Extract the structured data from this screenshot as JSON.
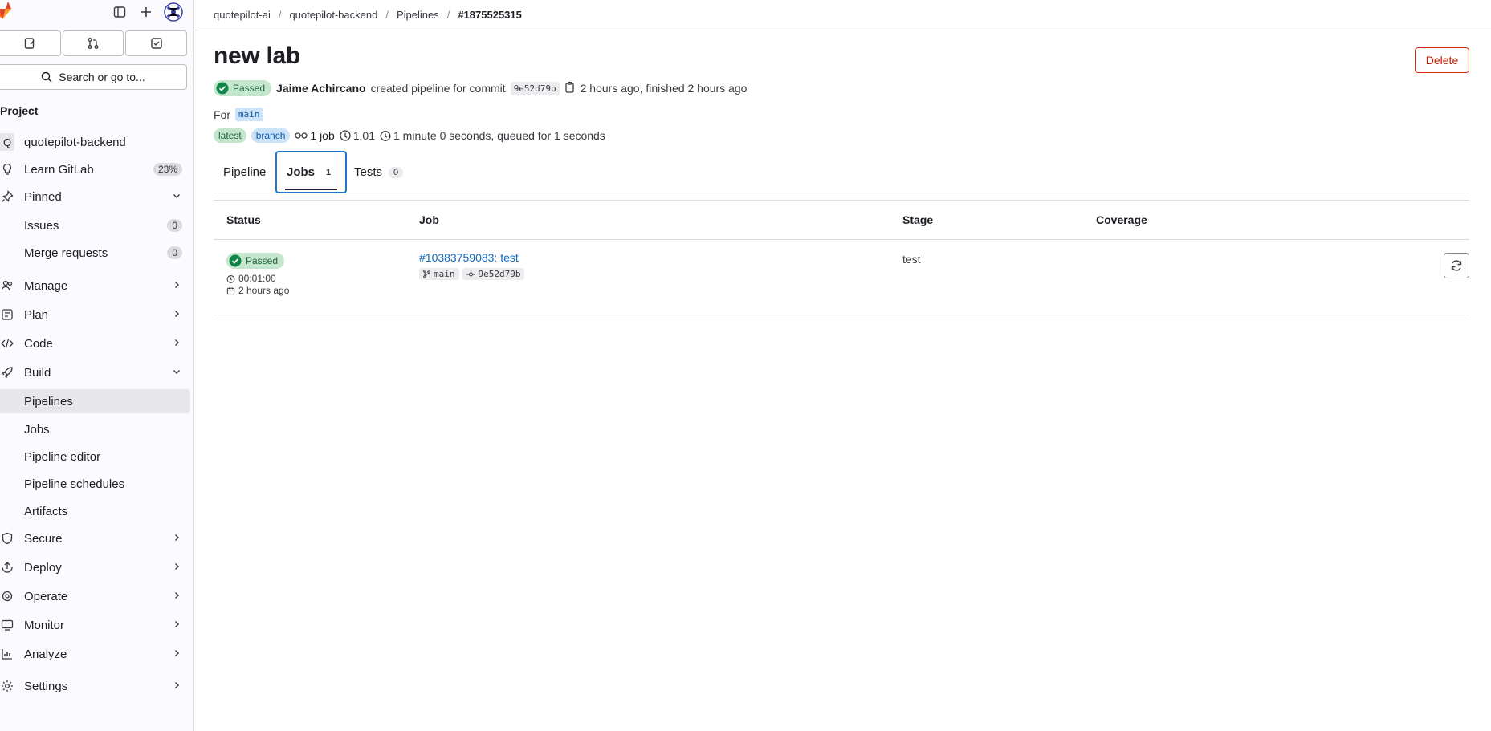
{
  "sidebar": {
    "search_label": "Search or go to...",
    "section_label": "Project",
    "project_initial": "Q",
    "project_name": "quotepilot-backend",
    "learn": {
      "label": "Learn GitLab",
      "badge": "23%"
    },
    "pinned": {
      "label": "Pinned"
    },
    "pinned_items": [
      {
        "label": "Issues",
        "badge": "0"
      },
      {
        "label": "Merge requests",
        "badge": "0"
      }
    ],
    "manage": "Manage",
    "plan": "Plan",
    "code": "Code",
    "build": "Build",
    "build_items": [
      "Pipelines",
      "Jobs",
      "Pipeline editor",
      "Pipeline schedules",
      "Artifacts"
    ],
    "secure": "Secure",
    "deploy": "Deploy",
    "operate": "Operate",
    "monitor": "Monitor",
    "analyze": "Analyze",
    "settings": "Settings"
  },
  "breadcrumb": [
    "quotepilot-ai",
    "quotepilot-backend",
    "Pipelines",
    "#1875525315"
  ],
  "page": {
    "title": "new lab",
    "delete_label": "Delete",
    "status": "Passed",
    "author": "Jaime Achircano",
    "created_text": "created pipeline for commit",
    "commit_sha": "9e52d79b",
    "time_text": "2 hours ago, finished 2 hours ago",
    "for_label": "For",
    "branch": "main",
    "tags": [
      "latest",
      "branch"
    ],
    "jobs_count": "1 job",
    "score": "1.01",
    "duration_text": "1 minute 0 seconds, queued for 1 seconds"
  },
  "tabs": [
    {
      "label": "Pipeline"
    },
    {
      "label": "Jobs",
      "count": "1"
    },
    {
      "label": "Tests",
      "count": "0"
    }
  ],
  "table": {
    "headers": [
      "Status",
      "Job",
      "Stage",
      "Coverage"
    ],
    "rows": [
      {
        "status": "Passed",
        "duration": "00:01:00",
        "finished": "2 hours ago",
        "job": "#10383759083: test",
        "ref": "main",
        "commit": "9e52d79b",
        "stage": "test",
        "coverage": ""
      }
    ]
  },
  "colors": {
    "accent": "#1f75cb",
    "success_bg": "#c3e6cd",
    "success_fg": "#24663b",
    "danger": "#dd2b0e",
    "link": "#1068bf"
  }
}
